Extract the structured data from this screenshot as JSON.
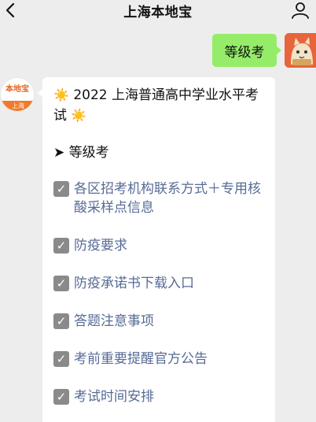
{
  "header": {
    "title": "上海本地宝"
  },
  "outgoing": {
    "text": "等级考"
  },
  "bot_avatar": {
    "logo_text": "本地宝",
    "band_text": "上海"
  },
  "incoming": {
    "headline": "2022 上海普通高中学业水平考试",
    "section_label": "等级考",
    "items": [
      {
        "label": "各区招考机构联系方式＋专用核酸采样点信息"
      },
      {
        "label": "防疫要求"
      },
      {
        "label": "防疫承诺书下载入口"
      },
      {
        "label": "答题注意事项"
      },
      {
        "label": "考前重要提醒官方公告"
      },
      {
        "label": "考试时间安排"
      }
    ]
  },
  "colors": {
    "background": "#ededed",
    "outgoing_bubble": "#95ec69",
    "link": "#576b95",
    "check_box": "#8a8a8a"
  },
  "icons": {
    "back": "chevron-left-icon",
    "profile": "person-icon",
    "sun": "sun-icon",
    "arrow": "arrow-right-icon",
    "check": "checkbox-icon"
  }
}
